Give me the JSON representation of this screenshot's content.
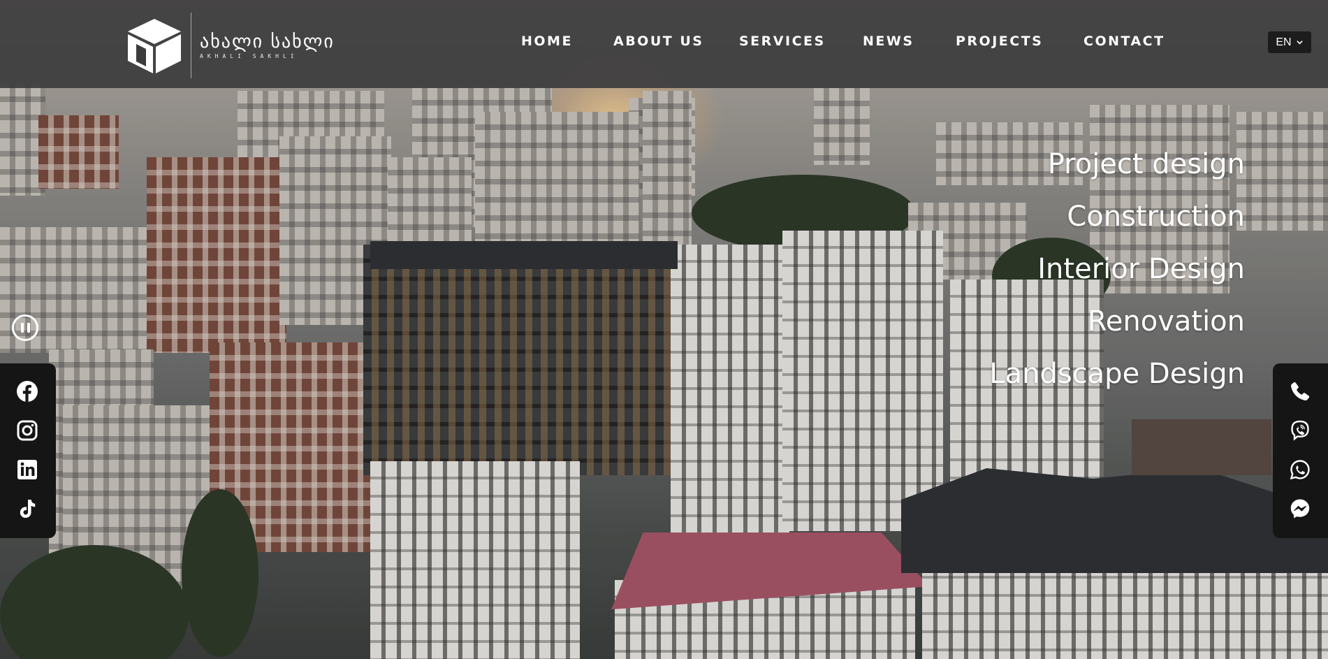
{
  "brand": {
    "name_georgian": "ახალი სახლი",
    "name_latin": "AKHALI SAKHLI",
    "logo_icon": "cube-house-icon"
  },
  "nav": {
    "items": [
      {
        "label": "HOME"
      },
      {
        "label": "ABOUT US"
      },
      {
        "label": "SERVICES"
      },
      {
        "label": "NEWS"
      },
      {
        "label": "PROJECTS"
      },
      {
        "label": "CONTACT"
      }
    ]
  },
  "language": {
    "selected": "EN",
    "icon": "chevron-down-icon"
  },
  "hero": {
    "services": [
      {
        "label": "Project design"
      },
      {
        "label": "Construction"
      },
      {
        "label": "Interior Design"
      },
      {
        "label": "Renovation"
      },
      {
        "label": "Landscape Design"
      }
    ],
    "video_control_icon": "pause-icon"
  },
  "social_links": [
    {
      "icon": "facebook-icon"
    },
    {
      "icon": "instagram-icon"
    },
    {
      "icon": "linkedin-icon"
    },
    {
      "icon": "tiktok-icon"
    }
  ],
  "contact_links": [
    {
      "icon": "phone-icon"
    },
    {
      "icon": "viber-icon"
    },
    {
      "icon": "whatsapp-icon"
    },
    {
      "icon": "messenger-icon"
    }
  ],
  "colors": {
    "header_bg": "#3c3c3e",
    "panel_bg": "#151516",
    "text": "#ffffff",
    "lang_bg": "#1c1c1d"
  }
}
